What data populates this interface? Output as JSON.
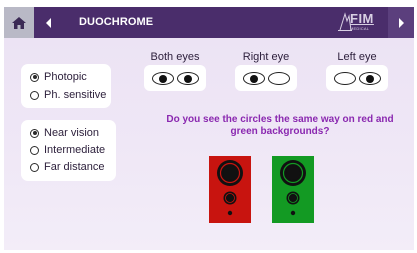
{
  "header": {
    "title": "DUOCHROME",
    "logo_text": "FIM",
    "logo_subtext": "MEDICAL"
  },
  "icons": {
    "home": "home-icon",
    "back": "chevron-left-icon",
    "next": "chevron-right-icon"
  },
  "lighting": {
    "options": [
      "Photopic",
      "Ph. sensitive"
    ],
    "selected": "Photopic"
  },
  "distance": {
    "options": [
      "Near vision",
      "Intermediate",
      "Far distance"
    ],
    "selected": "Near vision"
  },
  "eye_selector": {
    "both_label": "Both eyes",
    "right_label": "Right eye",
    "left_label": "Left eye"
  },
  "question": "Do you see the circles the same way on red and green backgrounds?",
  "colors": {
    "header": "#4a2d6b",
    "accent": "#8a28b0",
    "red_panel": "#c8140f",
    "green_panel": "#139a23"
  }
}
